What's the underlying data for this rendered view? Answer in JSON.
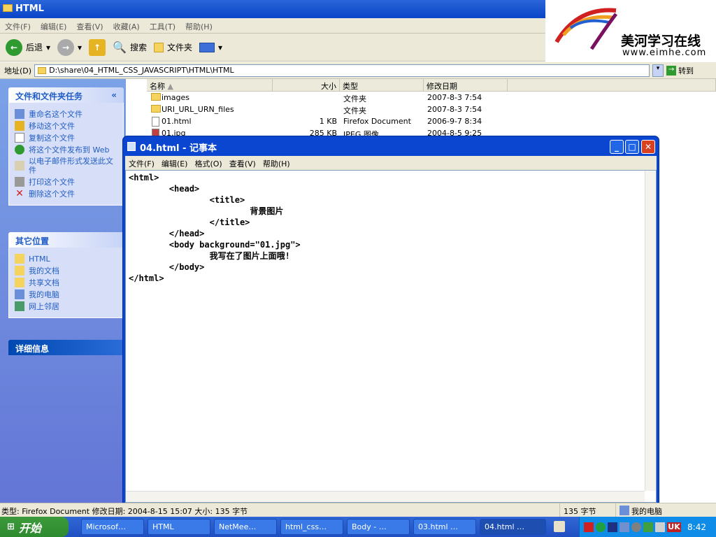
{
  "explorer": {
    "title": "HTML",
    "menu": [
      "文件(F)",
      "编辑(E)",
      "查看(V)",
      "收藏(A)",
      "工具(T)",
      "帮助(H)"
    ],
    "back": "后退",
    "search": "搜索",
    "folders": "文件夹",
    "address_label": "地址(D)",
    "address": "D:\\share\\04_HTML_CSS_JAVASCRIPT\\HTML\\HTML",
    "go": "转到"
  },
  "logo": {
    "name": "美河学习在线",
    "url": "www.eimhe.com"
  },
  "sidebar": {
    "tasks_title": "文件和文件夹任务",
    "tasks": [
      "重命名这个文件",
      "移动这个文件",
      "复制这个文件",
      "将这个文件发布到 Web",
      "以电子邮件形式发送此文件",
      "打印这个文件",
      "删除这个文件"
    ],
    "places_title": "其它位置",
    "places": [
      "HTML",
      "我的文档",
      "共享文档",
      "我的电脑",
      "网上邻居"
    ],
    "details_title": "详细信息"
  },
  "columns": [
    "名称",
    "大小",
    "类型",
    "修改日期"
  ],
  "files": [
    {
      "name": "images",
      "size": "",
      "type": "文件夹",
      "date": "2007-8-3 7:54"
    },
    {
      "name": "URI_URL_URN_files",
      "size": "",
      "type": "文件夹",
      "date": "2007-8-3 7:54"
    },
    {
      "name": "01.html",
      "size": "1 KB",
      "type": "Firefox Document",
      "date": "2006-9-7 8:34"
    },
    {
      "name": "01.jpg",
      "size": "285 KB",
      "type": "JPEG 图像",
      "date": "2004-8-5 9:25"
    }
  ],
  "notepad": {
    "title": "04.html - 记事本",
    "menu": [
      "文件(F)",
      "编辑(E)",
      "格式(O)",
      "查看(V)",
      "帮助(H)"
    ],
    "content": "<html>\n        <head>\n                <title>\n                        背景图片\n                </title>\n        </head>\n        <body background=\"01.jpg\">\n                我写在了图片上面哦!\n        </body>\n</html>"
  },
  "status": {
    "left": "类型: Firefox Document 修改日期: 2004-8-15 15:07 大小: 135 字节",
    "size": "135 字节",
    "computer": "我的电脑"
  },
  "taskbar": {
    "start": "开始",
    "items": [
      "Microsof…",
      "HTML",
      "NetMee…",
      "html_css…",
      "Body - …",
      "03.html …",
      "04.html …"
    ],
    "time": "8:42"
  }
}
